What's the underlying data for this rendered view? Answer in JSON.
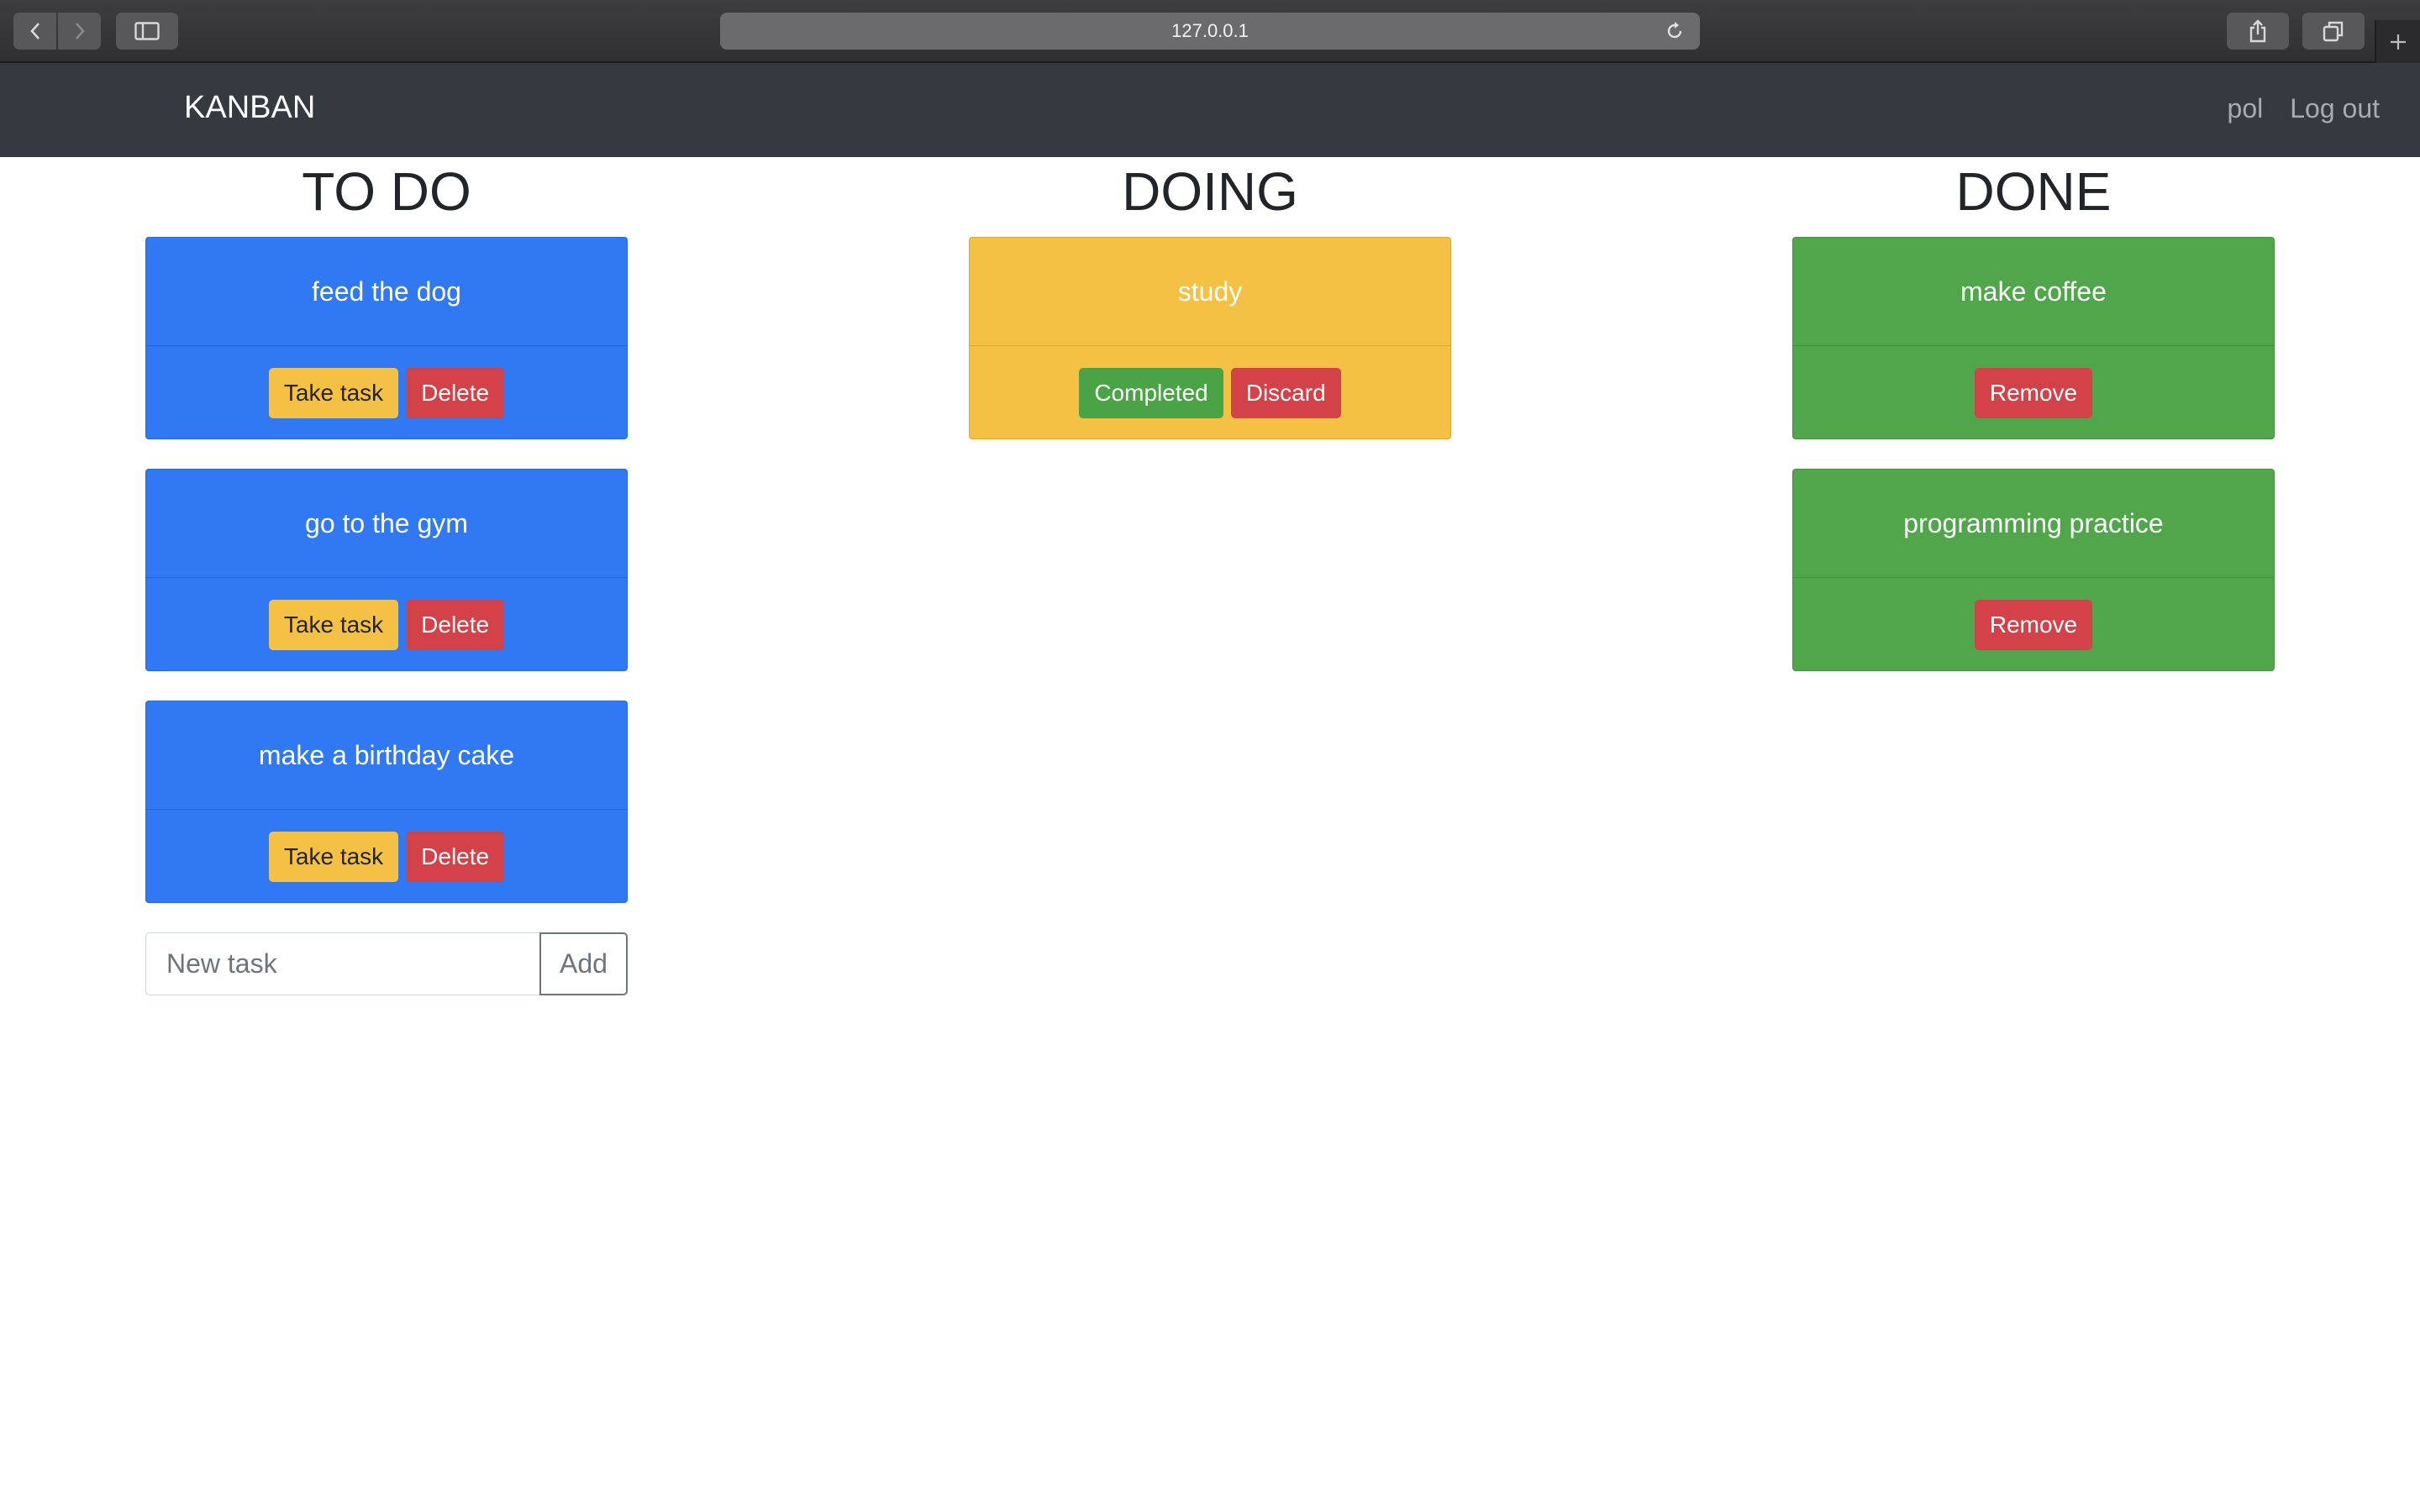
{
  "browser": {
    "url": "127.0.0.1"
  },
  "navbar": {
    "brand": "KANBAN",
    "user": "pol",
    "logout": "Log out"
  },
  "columns": {
    "todo": {
      "title": "TO DO",
      "cards": [
        {
          "text": "feed the dog",
          "take_label": "Take task",
          "delete_label": "Delete"
        },
        {
          "text": "go to the gym",
          "take_label": "Take task",
          "delete_label": "Delete"
        },
        {
          "text": "make a birthday cake",
          "take_label": "Take task",
          "delete_label": "Delete"
        }
      ],
      "new_task_placeholder": "New task",
      "add_label": "Add"
    },
    "doing": {
      "title": "DOING",
      "cards": [
        {
          "text": "study",
          "completed_label": "Completed",
          "discard_label": "Discard"
        }
      ]
    },
    "done": {
      "title": "DONE",
      "cards": [
        {
          "text": "make coffee",
          "remove_label": "Remove"
        },
        {
          "text": "programming practice",
          "remove_label": "Remove"
        }
      ]
    }
  },
  "colors": {
    "todo_card": "#3079f2",
    "doing_card": "#f5c144",
    "done_card": "#51a64b",
    "navbar": "#343a40",
    "danger": "#d24248",
    "warning": "#f5c144",
    "success": "#4aa345"
  }
}
